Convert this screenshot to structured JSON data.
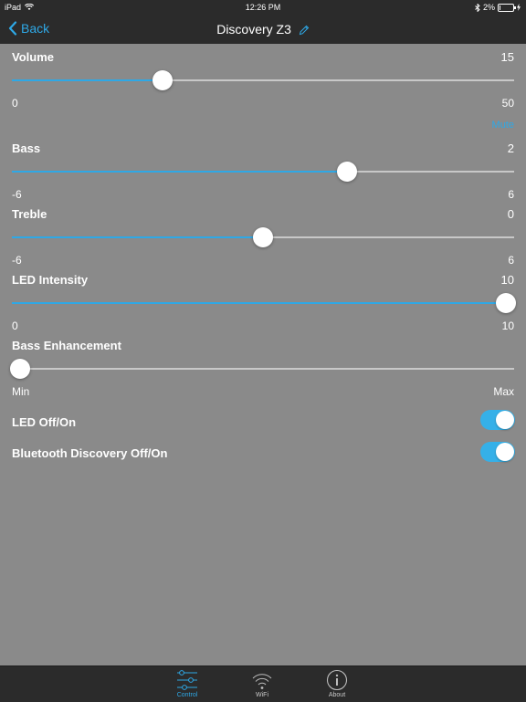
{
  "status_bar": {
    "device": "iPad",
    "time": "12:26 PM",
    "battery": "2%"
  },
  "nav": {
    "back_label": "Back",
    "title": "Discovery Z3"
  },
  "volume": {
    "label": "Volume",
    "value": "15",
    "min": "0",
    "max": "50",
    "fraction": 0.3,
    "mute_label": "Mute"
  },
  "bass": {
    "label": "Bass",
    "value": "2",
    "min": "-6",
    "max": "6",
    "fraction": 0.667
  },
  "treble": {
    "label": "Treble",
    "value": "0",
    "min": "-6",
    "max": "6",
    "fraction": 0.5
  },
  "led_intensity": {
    "label": "LED Intensity",
    "value": "10",
    "min": "0",
    "max": "10",
    "fraction": 1.0
  },
  "bass_enhancement": {
    "label": "Bass Enhancement",
    "min": "Min",
    "max": "Max",
    "fraction": 0.0
  },
  "led_toggle": {
    "label": "LED Off/On",
    "on": true
  },
  "bluetooth_toggle": {
    "label": "Bluetooth Discovery Off/On",
    "on": true
  },
  "tabs": [
    {
      "label": "Control",
      "icon": "sliders-icon",
      "active": true
    },
    {
      "label": "WiFi",
      "icon": "wifi-icon",
      "active": false
    },
    {
      "label": "About",
      "icon": "info-icon",
      "active": false
    }
  ],
  "colors": {
    "accent": "#2ea8e6",
    "background": "#8a8a8a",
    "bar": "#2b2b2b"
  }
}
